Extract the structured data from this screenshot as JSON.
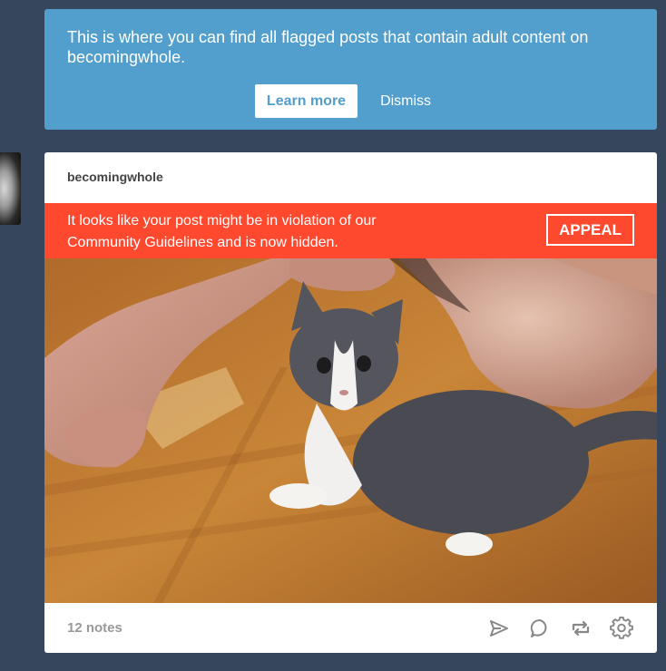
{
  "banner": {
    "message": "This is where you can find all flagged posts that contain adult content on becomingwhole.",
    "learn_more_label": "Learn more",
    "dismiss_label": "Dismiss"
  },
  "post": {
    "blog_name": "becomingwhole",
    "violation_message": "It looks like your post might be in violation of our Community Guidelines and is now hidden.",
    "appeal_label": "APPEAL",
    "image_description": "photo",
    "notes_label": "12 notes",
    "footer_icons": [
      "share-icon",
      "reply-icon",
      "reblog-icon",
      "settings-icon"
    ]
  },
  "colors": {
    "background": "#36465d",
    "banner": "#529ecc",
    "violation": "#ff492f",
    "icon": "#888888"
  }
}
